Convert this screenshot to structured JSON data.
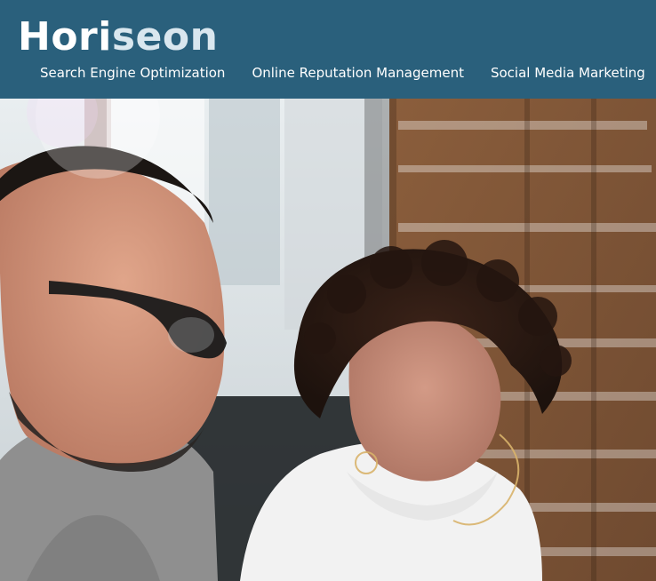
{
  "header": {
    "brand": {
      "prefix": "Hori",
      "suffix": "seon"
    },
    "nav": [
      {
        "label": "Search Engine Optimization"
      },
      {
        "label": "Online Reputation Management"
      },
      {
        "label": "Social Media Marketing"
      }
    ]
  },
  "hero": {
    "image": "hero-photo"
  },
  "colors": {
    "header_bg": "#2a607c",
    "brand_text": "#ffffff",
    "brand_accent": "#d9e7ef",
    "nav_text": "#ffffff"
  }
}
